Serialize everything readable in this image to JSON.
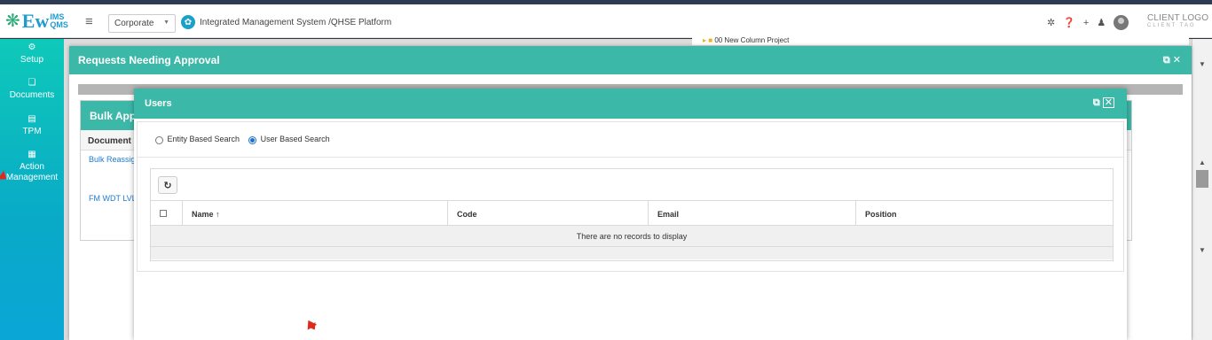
{
  "header": {
    "logo_prefix": "Ew",
    "logo_ims": "IMS",
    "logo_qms": "QMS",
    "org_select": "Corporate",
    "platform_title": "Integrated Management System /QHSE Platform",
    "client_logo": "CLIENT LOGO",
    "client_logo_tagline": "CLIENT TAG",
    "icons": [
      "settings-icon",
      "help-icon",
      "plus-icon",
      "bell-icon",
      "avatar"
    ]
  },
  "sidebar": {
    "items": [
      {
        "label": "Setup",
        "icon": "setup-icon"
      },
      {
        "label": "Documents",
        "icon": "documents-icon"
      },
      {
        "label": "TPM",
        "icon": "tpm-icon"
      },
      {
        "label": "Action Management",
        "icon": "action-icon"
      }
    ]
  },
  "background": {
    "tree_node": "00 New Column Project"
  },
  "requests_modal": {
    "title": "Requests Needing Approval",
    "bulk_title": "Bulk Appr",
    "column_header": "Document I",
    "rows": [
      "Bulk Reassig",
      "FM WDT LVL"
    ]
  },
  "users_modal": {
    "title": "Users",
    "search_options": [
      {
        "label": "Entity Based Search",
        "selected": false
      },
      {
        "label": "User Based Search",
        "selected": true
      }
    ],
    "columns": [
      "Name",
      "Code",
      "Email",
      "Position"
    ],
    "sort_indicator": "↑",
    "empty_message": "There are no records to display"
  },
  "colors": {
    "accent": "#3cb8a8",
    "sidebar_top": "#0ec9b9",
    "sidebar_bottom": "#0aa6d6",
    "link": "#1e7bd1"
  }
}
